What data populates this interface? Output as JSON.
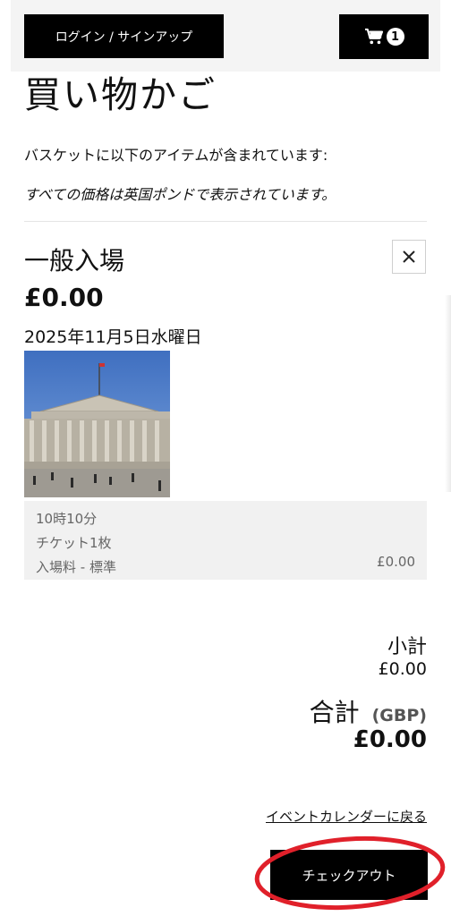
{
  "header": {
    "login_label": "ログイン / サインアップ",
    "cart_icon": "cart-icon",
    "cart_count": "1"
  },
  "page": {
    "title": "買い物かご",
    "intro": "バスケットに以下のアイテムが含まれています:",
    "currency_note": "すべての価格は英国ポンドで表示されています。"
  },
  "cart_item": {
    "name": "一般入場",
    "price": "£0.00",
    "date": "2025年11月5日水曜日",
    "remove_icon": "close-icon",
    "image_subject": "museum-facade",
    "details": {
      "time": "10時10分",
      "quantity": "チケット1枚",
      "ticket_type": "入場料 - 標準",
      "line_price": "£0.00"
    }
  },
  "summary": {
    "subtotal_label": "小計",
    "subtotal_value": "£0.00",
    "total_label": "合計",
    "currency_code": "(GBP)",
    "total_value": "£0.00"
  },
  "actions": {
    "back_link": "イベントカレンダーに戻る",
    "checkout_label": "チェックアウト"
  },
  "colors": {
    "button_bg": "#000000",
    "annotation_red": "#e0202a"
  }
}
